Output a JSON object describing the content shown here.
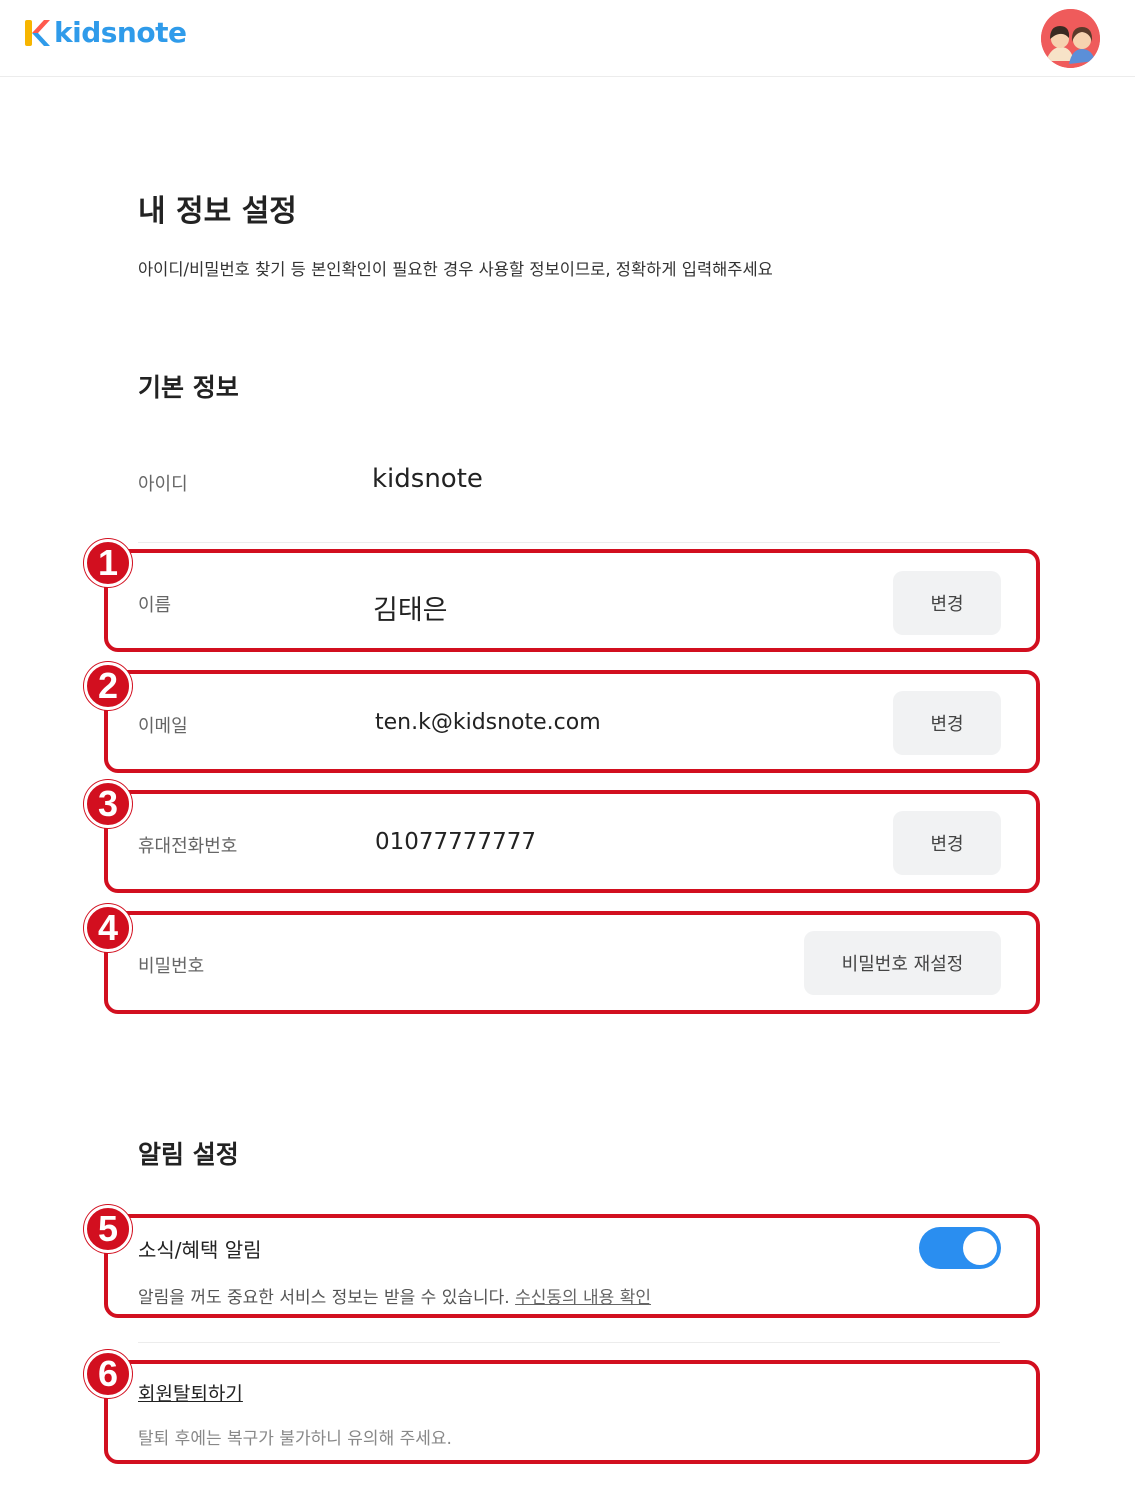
{
  "header": {
    "logo_text": "kidsnote",
    "avatar_icon": "family-avatar-icon"
  },
  "page": {
    "title": "내 정보 설정",
    "description": "아이디/비밀번호 찾기 등 본인확인이 필요한 경우 사용할 정보이므로, 정확하게 입력해주세요"
  },
  "basic_info": {
    "title": "기본 정보",
    "id": {
      "label": "아이디",
      "value": "kidsnote"
    },
    "name": {
      "label": "이름",
      "value": "김태은",
      "button": "변경"
    },
    "email": {
      "label": "이메일",
      "value": "ten.k@kidsnote.com",
      "button": "변경"
    },
    "phone": {
      "label": "휴대전화번호",
      "value": "01077777777",
      "button": "변경"
    },
    "password": {
      "label": "비밀번호",
      "button": "비밀번호 재설정"
    }
  },
  "notifications": {
    "title": "알림 설정",
    "news_label": "소식/혜택 알림",
    "toggle_on": true,
    "note_text": "알림을 꺼도 중요한 서비스 정보는 받을 수 있습니다.",
    "note_link": "수신동의 내용 확인"
  },
  "withdraw": {
    "link": "회원탈퇴하기",
    "note": "탈퇴 후에는 복구가 불가하니 유의해 주세요."
  },
  "annotations": [
    "1",
    "2",
    "3",
    "4",
    "5",
    "6"
  ],
  "colors": {
    "accent": "#2a8ef0",
    "highlight": "#d20f1f",
    "button_bg": "#f1f2f3"
  }
}
